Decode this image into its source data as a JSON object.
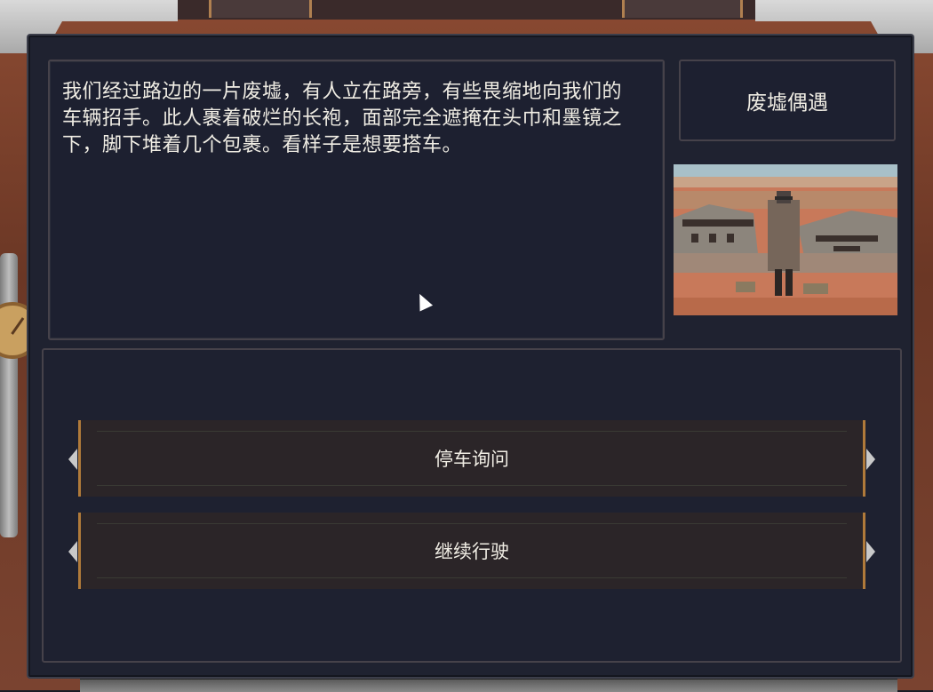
{
  "event": {
    "title": "废墟偶遇",
    "description": "我们经过路边的一片废墟，有人立在路旁，有些畏缩地向我们的车辆招手。此人裹着破烂的长袍，面部完全遮掩在头巾和墨镜之下，脚下堆着几个包裹。看样子是想要搭车。"
  },
  "choices": [
    {
      "label": "停车询问"
    },
    {
      "label": "继续行驶"
    }
  ],
  "scene_image": {
    "icon": "ruins-hitchhiker-scene",
    "colors": {
      "sky": "#9fb6c0",
      "ground": "#c8795a",
      "ruins": "#8c857c",
      "figure": "#6b5a50"
    }
  }
}
